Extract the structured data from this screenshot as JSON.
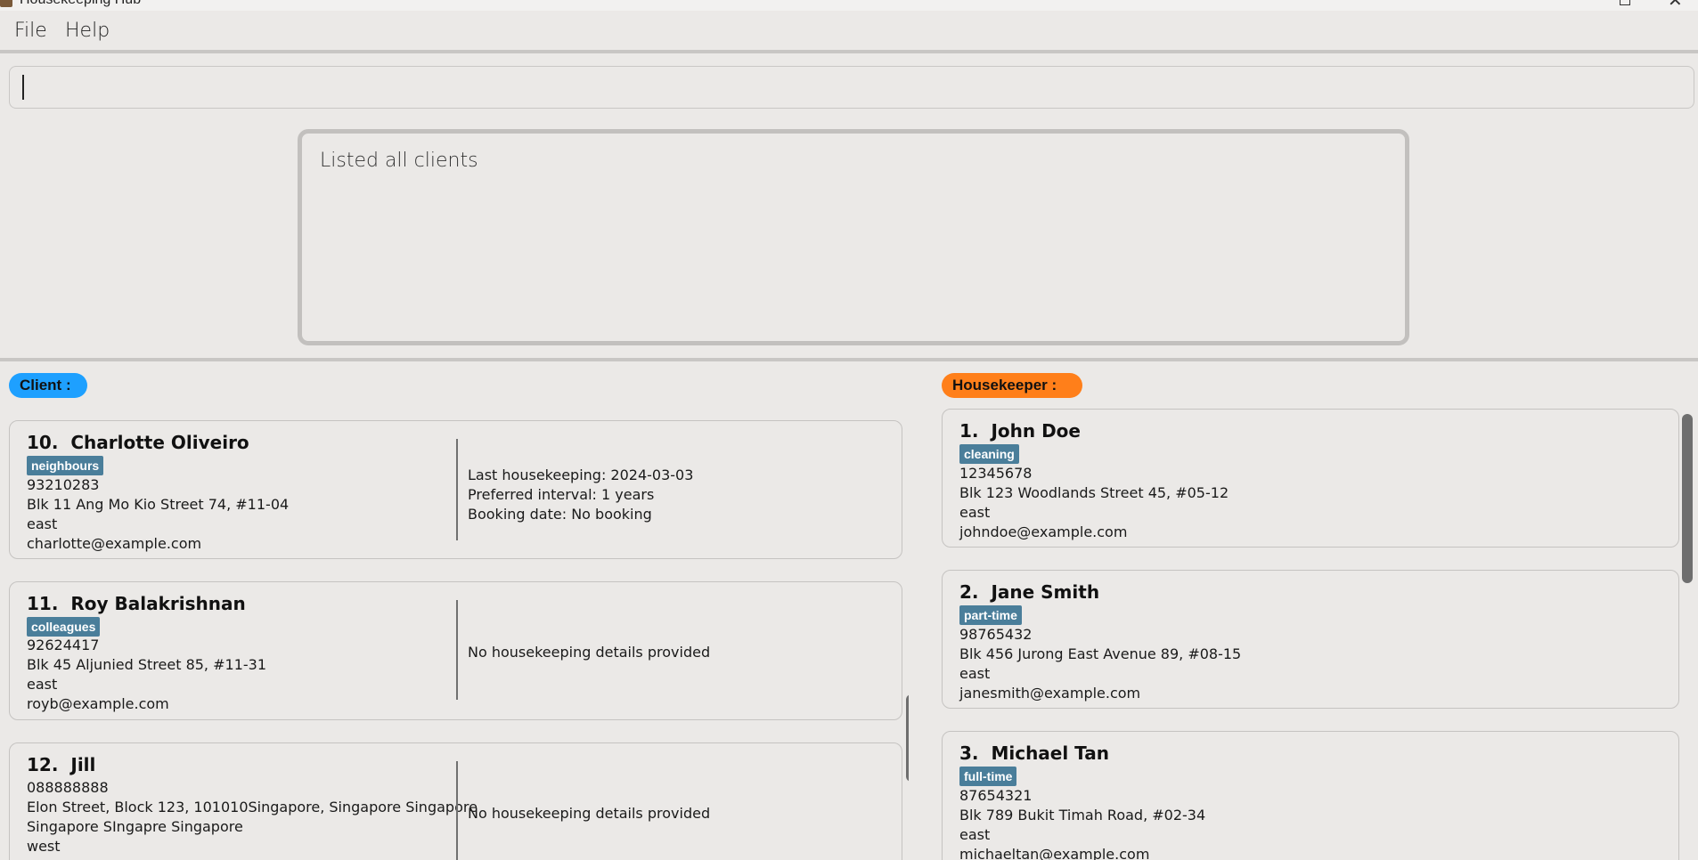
{
  "window": {
    "title": "Housekeeping Hub"
  },
  "menu": {
    "file": "File",
    "help": "Help"
  },
  "command": {
    "value": ""
  },
  "result": {
    "message": "Listed all clients"
  },
  "client_header": "Client :",
  "housekeeper_header": "Housekeeper :",
  "clients": [
    {
      "index": "10.",
      "name": "Charlotte Oliveiro",
      "tag": "neighbours",
      "phone": "93210283",
      "address": "Blk 11 Ang Mo Kio Street 74, #11-04",
      "area": "east",
      "email": "charlotte@example.com",
      "last_housekeeping": "Last housekeeping: 2024-03-03",
      "preferred_interval": "Preferred interval: 1 years",
      "booking_date": "Booking date: No booking"
    },
    {
      "index": "11.",
      "name": "Roy Balakrishnan",
      "tag": "colleagues",
      "phone": "92624417",
      "address": "Blk 45 Aljunied Street 85, #11-31",
      "area": "east",
      "email": "royb@example.com",
      "details": "No housekeeping details provided"
    },
    {
      "index": "12.",
      "name": "Jill",
      "phone": "088888888",
      "address_line1": "Elon Street, Block 123, 101010Singapore, Singapore Singapore",
      "address_line2": "Singapore SIngapre Singapore",
      "area": "west",
      "details": "No housekeeping details provided"
    }
  ],
  "housekeepers": [
    {
      "index": "1.",
      "name": "John Doe",
      "tag": "cleaning",
      "phone": "12345678",
      "address": "Blk 123 Woodlands Street 45, #05-12",
      "area": "east",
      "email": "johndoe@example.com"
    },
    {
      "index": "2.",
      "name": "Jane Smith",
      "tag": "part-time",
      "phone": "98765432",
      "address": "Blk 456 Jurong East Avenue 89, #08-15",
      "area": "east",
      "email": "janesmith@example.com"
    },
    {
      "index": "3.",
      "name": "Michael Tan",
      "tag": "full-time",
      "phone": "87654321",
      "address": "Blk 789 Bukit Timah Road, #02-34",
      "area": "east",
      "email": "michaeltan@example.com"
    }
  ]
}
